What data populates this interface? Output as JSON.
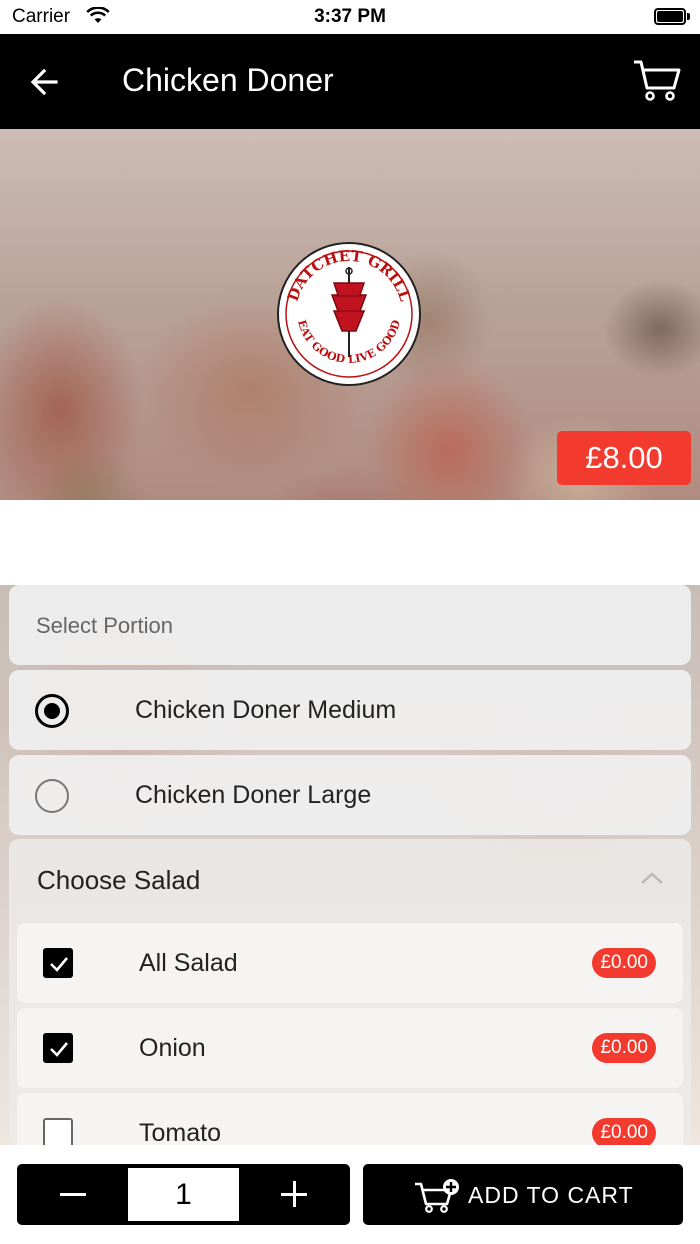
{
  "status_bar": {
    "carrier": "Carrier",
    "time": "3:37 PM"
  },
  "nav": {
    "title": "Chicken Doner",
    "back_icon": "arrow-left-icon",
    "cart_icon": "cart-icon"
  },
  "hero": {
    "price": "£8.00",
    "logo": {
      "top_text": "DATCHET GRILL",
      "bottom_text": "EAT GOOD LIVE GOOD"
    }
  },
  "portion": {
    "header": "Select Portion",
    "options": [
      {
        "label": "Chicken Doner Medium",
        "selected": true
      },
      {
        "label": "Chicken Doner Large",
        "selected": false
      }
    ]
  },
  "salad": {
    "title": "Choose Salad",
    "items": [
      {
        "label": "All Salad",
        "price": "£0.00",
        "checked": true
      },
      {
        "label": "Onion",
        "price": "£0.00",
        "checked": true
      },
      {
        "label": "Tomato",
        "price": "£0.00",
        "checked": false
      }
    ]
  },
  "bottom": {
    "quantity": "1",
    "add_to_cart_label": "ADD TO CART"
  },
  "colors": {
    "accent": "#f23a2f",
    "bar": "#000000"
  }
}
